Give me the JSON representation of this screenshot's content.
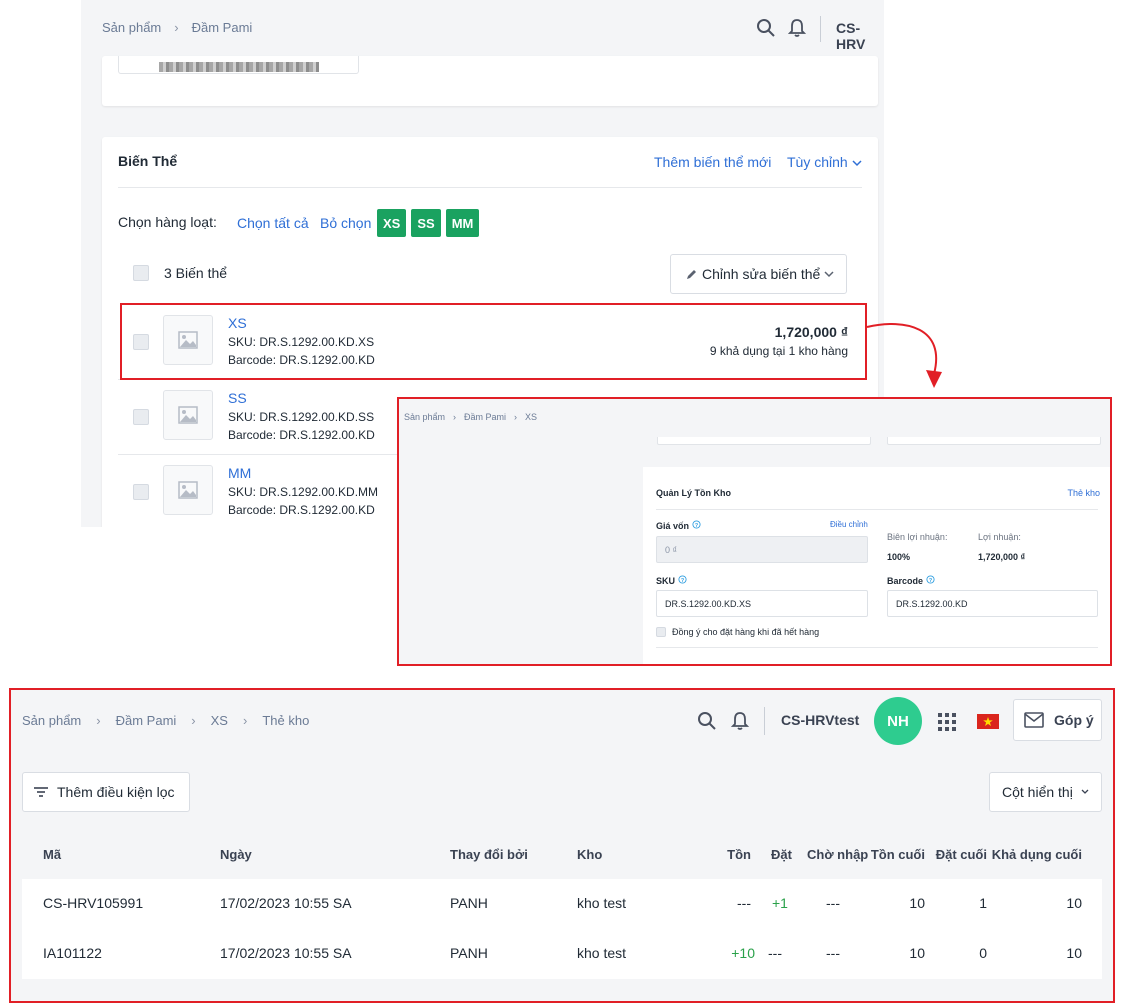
{
  "variants_panel": {
    "breadcrumb": [
      "Sản phẩm",
      "Đầm Pami"
    ],
    "user_short": "CS-HRV",
    "section_title": "Biến Thể",
    "add_variant_link": "Thêm biến thể mới",
    "customize_link": "Tùy chỉnh",
    "bulk_label": "Chọn hàng loạt:",
    "select_all": "Chọn tất cả",
    "deselect": "Bỏ chọn",
    "chips": [
      "XS",
      "SS",
      "MM"
    ],
    "variant_count": "3 Biến thể",
    "edit_variants_button": "Chỉnh sửa biến thể",
    "variants": [
      {
        "name": "XS",
        "sku": "SKU: DR.S.1292.00.KD.XS",
        "barcode": "Barcode: DR.S.1292.00.KD",
        "price": "1,720,000 ₫",
        "availability": "9 khả dụng tại 1 kho hàng"
      },
      {
        "name": "SS",
        "sku": "SKU: DR.S.1292.00.KD.SS",
        "barcode": "Barcode: DR.S.1292.00.KD"
      },
      {
        "name": "MM",
        "sku": "SKU: DR.S.1292.00.KD.MM",
        "barcode": "Barcode: DR.S.1292.00.KD"
      }
    ]
  },
  "inventory_panel": {
    "breadcrumb": [
      "Sản phẩm",
      "Đầm Pami",
      "XS"
    ],
    "title": "Quản Lý Tồn Kho",
    "stock_card_link": "Thẻ kho",
    "cost_label": "Giá vốn",
    "adjust_link": "Điều chỉnh",
    "cost_value": "0 ₫",
    "margin_label": "Biên lợi nhuận:",
    "margin_value": "100%",
    "profit_label": "Lợi nhuận:",
    "profit_value": "1,720,000 ₫",
    "sku_label": "SKU",
    "sku_value": "DR.S.1292.00.KD.XS",
    "barcode_label": "Barcode",
    "barcode_value": "DR.S.1292.00.KD",
    "oversell_label": "Đồng ý cho đặt hàng khi đã hết hàng"
  },
  "stock_card_panel": {
    "breadcrumb": [
      "Sản phẩm",
      "Đầm Pami",
      "XS",
      "Thẻ kho"
    ],
    "user_name": "CS-HRVtest",
    "avatar_initials": "NH",
    "feedback_button": "Góp ý",
    "filter_button": "Thêm điều kiện lọc",
    "columns_button": "Cột hiển thị",
    "columns": [
      "Mã",
      "Ngày",
      "Thay đổi bởi",
      "Kho",
      "Tồn",
      "Đặt",
      "Chờ nhập",
      "Tồn cuối",
      "Đặt cuối",
      "Khả dụng cuối"
    ],
    "rows": [
      {
        "code": "CS-HRV105991",
        "date": "17/02/2023 10:55 SA",
        "by": "PANH",
        "warehouse": "kho test",
        "stock": "---",
        "ordered": "+1",
        "incoming": "---",
        "end_stock": "10",
        "end_ordered": "1",
        "end_available": "10"
      },
      {
        "code": "IA101122",
        "date": "17/02/2023 10:55 SA",
        "by": "PANH",
        "warehouse": "kho test",
        "stock": "+10",
        "ordered": "---",
        "incoming": "---",
        "end_stock": "10",
        "end_ordered": "0",
        "end_available": "10"
      }
    ]
  },
  "colors": {
    "accent_green": "#1aa260",
    "highlight_red": "#e11f26",
    "link_blue": "#2f6fd6",
    "avatar_green": "#2ecc8f"
  },
  "icons": [
    "search-icon",
    "bell-icon",
    "image-placeholder-icon",
    "pencil-icon",
    "chevron-down-icon",
    "help-circle-icon",
    "grid-apps-icon",
    "vietnam-flag-icon",
    "mail-icon",
    "filter-icon",
    "arrow-connector-icon"
  ]
}
